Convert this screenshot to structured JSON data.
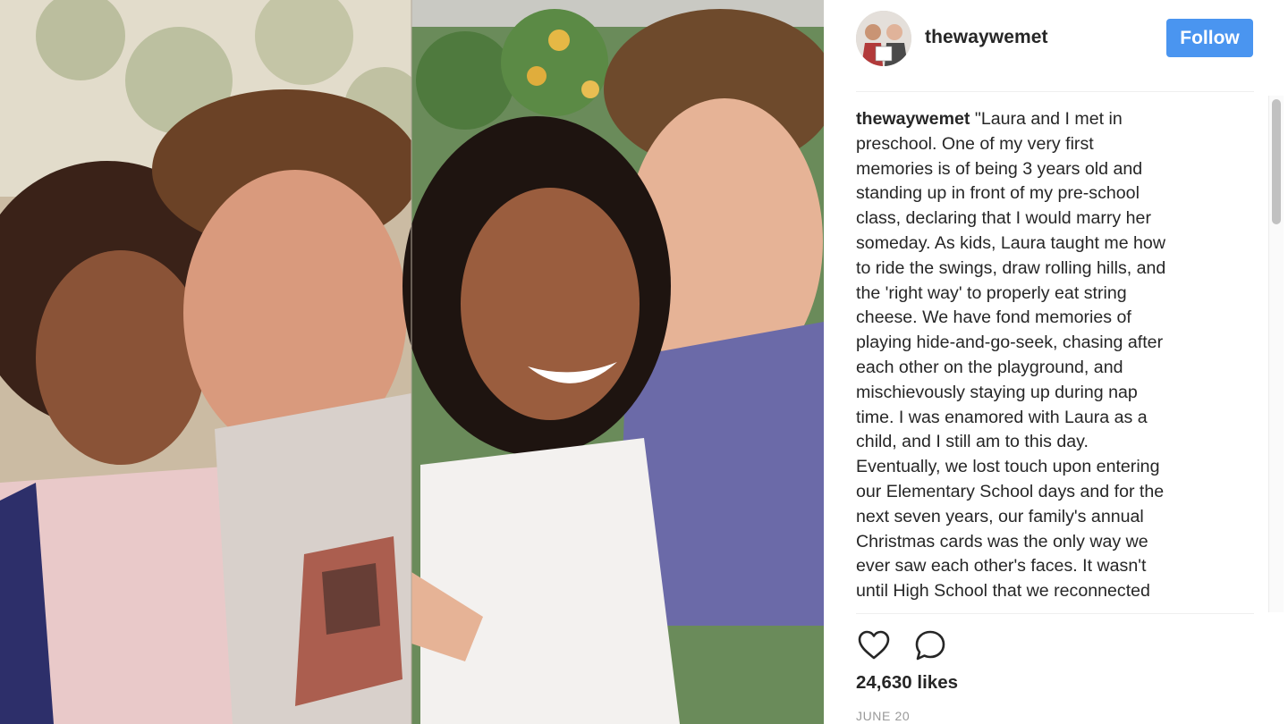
{
  "post": {
    "username": "thewaywemet",
    "follow_label": "Follow",
    "caption_username": "thewaywemet",
    "caption_text": " \"Laura and I met in\npreschool. One of my very first\nmemories is of being 3 years old and\nstanding up in front of my pre-school\nclass, declaring that I would marry her\nsomeday. As kids, Laura taught me how\nto ride the swings, draw rolling hills, and\nthe 'right way' to properly eat string\ncheese. We have fond memories of\nplaying hide-and-go-seek, chasing after\neach other on the playground, and\nmischievously staying up during nap\ntime. I was enamored with Laura as a\nchild, and I still am to this day.\nEventually, we lost touch upon entering\nour Elementary School days and for the\nnext seven years, our family's annual\nChristmas cards was the only way we\never saw each other's faces. It wasn't\nuntil High School that we reconnected",
    "likes": "24,630 likes",
    "date": "JUNE 20"
  },
  "icons": {
    "like": "heart-icon",
    "comment": "comment-bubble-icon"
  },
  "colors": {
    "follow_button": "#4a95f0",
    "text": "#262626",
    "muted": "#999999"
  }
}
